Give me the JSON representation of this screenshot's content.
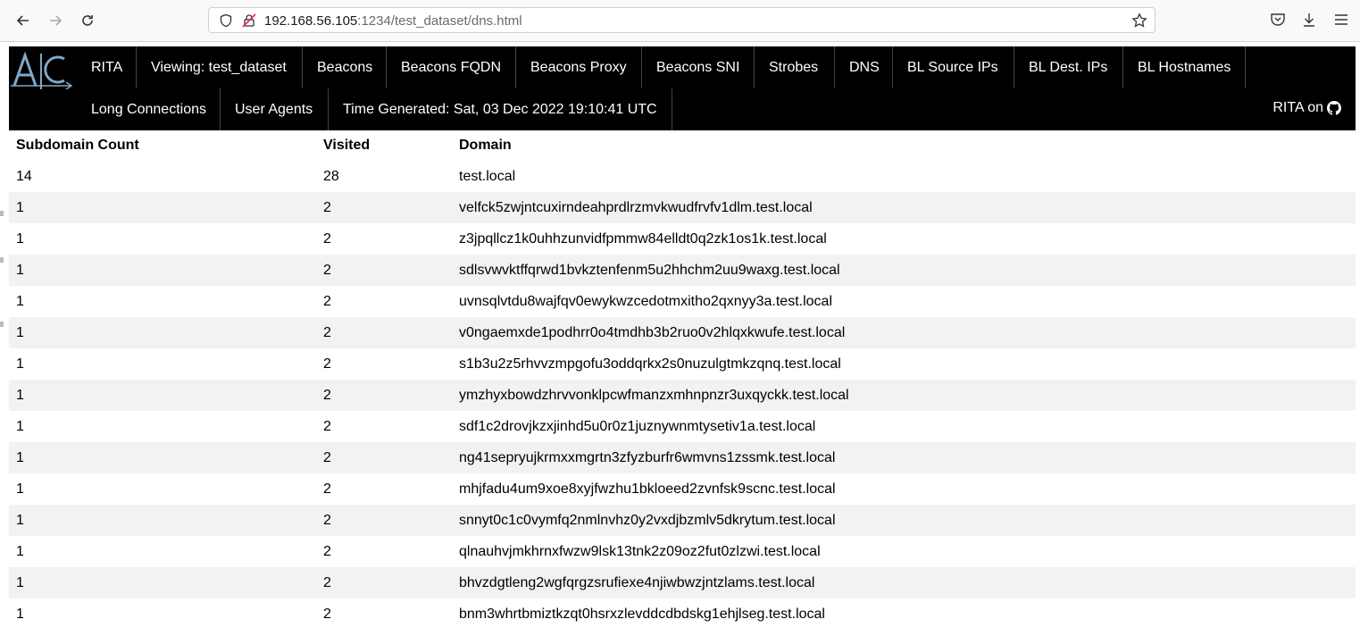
{
  "browser": {
    "url_host": "192.168.56.105",
    "url_rest": ":1234/test_dataset/dns.html"
  },
  "nav": {
    "row1": [
      "RITA",
      "Viewing: test_dataset",
      "Beacons",
      "Beacons FQDN",
      "Beacons Proxy",
      "Beacons SNI",
      "Strobes",
      "DNS",
      "BL Source IPs",
      "BL Dest. IPs",
      "BL Hostnames"
    ],
    "row2": [
      "Long Connections",
      "User Agents",
      "Time Generated: Sat, 03 Dec 2022 19:10:41 UTC"
    ],
    "github_label": "RITA on"
  },
  "table": {
    "headers": [
      "Subdomain Count",
      "Visited",
      "Domain"
    ],
    "rows": [
      [
        "14",
        "28",
        "test.local"
      ],
      [
        "1",
        "2",
        "velfck5zwjntcuxirndeahprdlrzmvkwudfrvfv1dlm.test.local"
      ],
      [
        "1",
        "2",
        "z3jpqllcz1k0uhhzunvidfpmmw84elldt0q2zk1os1k.test.local"
      ],
      [
        "1",
        "2",
        "sdlsvwvktffqrwd1bvkztenfenm5u2hhchm2uu9waxg.test.local"
      ],
      [
        "1",
        "2",
        "uvnsqlvtdu8wajfqv0ewykwzcedotmxitho2qxnyy3a.test.local"
      ],
      [
        "1",
        "2",
        "v0ngaemxde1podhrr0o4tmdhb3b2ruo0v2hlqxkwufe.test.local"
      ],
      [
        "1",
        "2",
        "s1b3u2z5rhvvzmpgofu3oddqrkx2s0nuzulgtmkzqnq.test.local"
      ],
      [
        "1",
        "2",
        "ymzhyxbowdzhrvvonklpcwfmanzxmhnpnzr3uxqyckk.test.local"
      ],
      [
        "1",
        "2",
        "sdf1c2drovjkzxjinhd5u0r0z1juznywnmtysetiv1a.test.local"
      ],
      [
        "1",
        "2",
        "ng41sepryujkrmxxmgrtn3zfyzburfr6wmvns1zssmk.test.local"
      ],
      [
        "1",
        "2",
        "mhjfadu4um9xoe8xyjfwzhu1bkloeed2zvnfsk9scnc.test.local"
      ],
      [
        "1",
        "2",
        "snnyt0c1c0vymfq2nmlnvhz0y2vxdjbzmlv5dkrytum.test.local"
      ],
      [
        "1",
        "2",
        "qlnauhvjmkhrnxfwzw9lsk13tnk2z09oz2fut0zlzwi.test.local"
      ],
      [
        "1",
        "2",
        "bhvzdgtleng2wgfqrgzsrufiexe4njiwbwzjntzlams.test.local"
      ],
      [
        "1",
        "2",
        "bnm3whrtbmiztkzqt0hsrxzlevddcdbdskg1ehjlseg.test.local"
      ]
    ]
  }
}
